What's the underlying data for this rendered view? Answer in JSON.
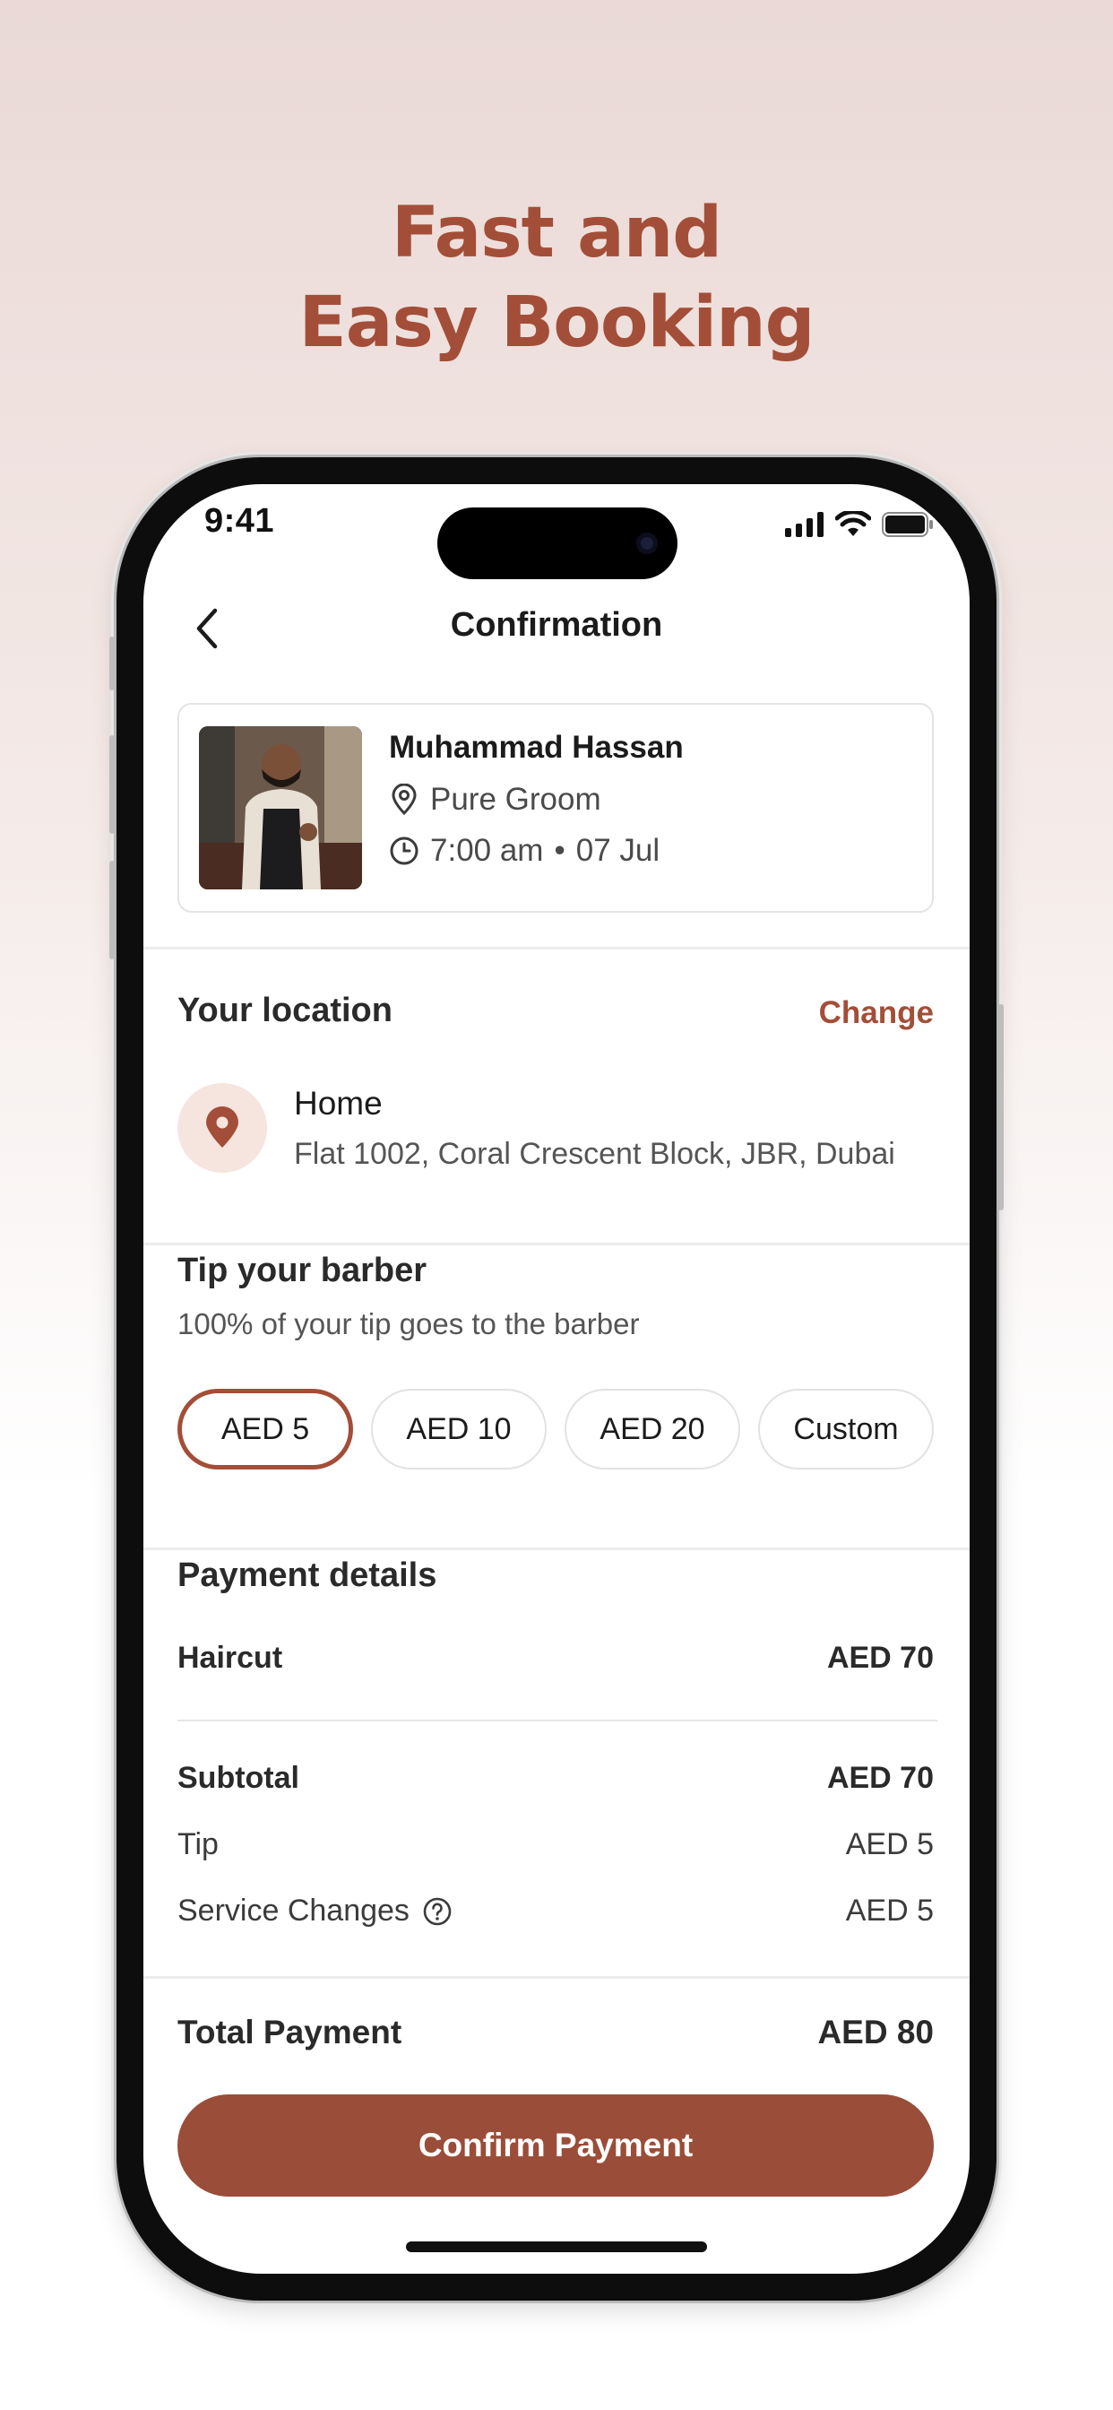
{
  "marketing": {
    "headline_line1": "Fast and",
    "headline_line2": "Easy Booking"
  },
  "status_bar": {
    "time": "9:41"
  },
  "nav": {
    "back_icon": "chevron-left-icon",
    "title": "Confirmation"
  },
  "booking": {
    "barber_name": "Muhammad Hassan",
    "shop_name": "Pure Groom",
    "time": "7:00 am",
    "separator": "•",
    "date": "07 Jul"
  },
  "location": {
    "section_title": "Your location",
    "change_label": "Change",
    "name": "Home",
    "address": "Flat 1002, Coral Crescent Block, JBR, Dubai"
  },
  "tip": {
    "section_title": "Tip your barber",
    "subtitle": "100% of your tip goes to the barber",
    "options": [
      "AED 5",
      "AED 10",
      "AED 20",
      "Custom"
    ],
    "selected": "AED 5"
  },
  "payment": {
    "section_title": "Payment details",
    "service_label": "Haircut",
    "service_value": "AED 70",
    "subtotal_label": "Subtotal",
    "subtotal_value": "AED 70",
    "tip_label": "Tip",
    "tip_value": "AED 5",
    "service_charges_label": "Service Changes",
    "service_charges_value": "AED 5",
    "total_label": "Total Payment",
    "total_value": "AED 80"
  },
  "actions": {
    "confirm_label": "Confirm Payment"
  },
  "colors": {
    "accent": "#a34e38",
    "button": "#9a4d39",
    "location_bg": "#f6e4df"
  }
}
